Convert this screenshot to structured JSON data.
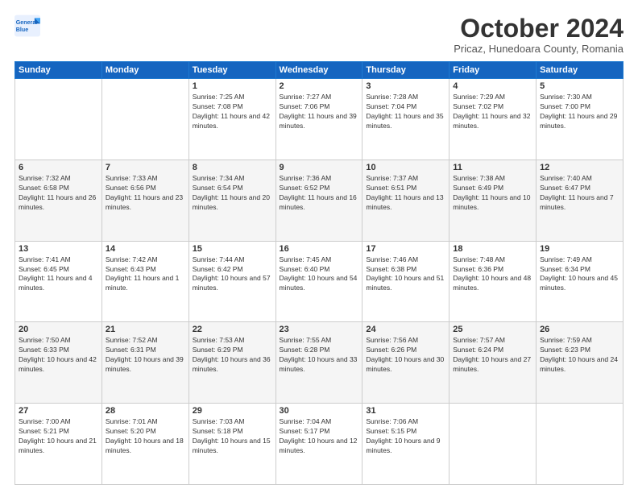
{
  "logo": {
    "line1": "General",
    "line2": "Blue"
  },
  "title": "October 2024",
  "location": "Pricaz, Hunedoara County, Romania",
  "days_of_week": [
    "Sunday",
    "Monday",
    "Tuesday",
    "Wednesday",
    "Thursday",
    "Friday",
    "Saturday"
  ],
  "weeks": [
    [
      {
        "day": "",
        "sunrise": "",
        "sunset": "",
        "daylight": ""
      },
      {
        "day": "",
        "sunrise": "",
        "sunset": "",
        "daylight": ""
      },
      {
        "day": "1",
        "sunrise": "Sunrise: 7:25 AM",
        "sunset": "Sunset: 7:08 PM",
        "daylight": "Daylight: 11 hours and 42 minutes."
      },
      {
        "day": "2",
        "sunrise": "Sunrise: 7:27 AM",
        "sunset": "Sunset: 7:06 PM",
        "daylight": "Daylight: 11 hours and 39 minutes."
      },
      {
        "day": "3",
        "sunrise": "Sunrise: 7:28 AM",
        "sunset": "Sunset: 7:04 PM",
        "daylight": "Daylight: 11 hours and 35 minutes."
      },
      {
        "day": "4",
        "sunrise": "Sunrise: 7:29 AM",
        "sunset": "Sunset: 7:02 PM",
        "daylight": "Daylight: 11 hours and 32 minutes."
      },
      {
        "day": "5",
        "sunrise": "Sunrise: 7:30 AM",
        "sunset": "Sunset: 7:00 PM",
        "daylight": "Daylight: 11 hours and 29 minutes."
      }
    ],
    [
      {
        "day": "6",
        "sunrise": "Sunrise: 7:32 AM",
        "sunset": "Sunset: 6:58 PM",
        "daylight": "Daylight: 11 hours and 26 minutes."
      },
      {
        "day": "7",
        "sunrise": "Sunrise: 7:33 AM",
        "sunset": "Sunset: 6:56 PM",
        "daylight": "Daylight: 11 hours and 23 minutes."
      },
      {
        "day": "8",
        "sunrise": "Sunrise: 7:34 AM",
        "sunset": "Sunset: 6:54 PM",
        "daylight": "Daylight: 11 hours and 20 minutes."
      },
      {
        "day": "9",
        "sunrise": "Sunrise: 7:36 AM",
        "sunset": "Sunset: 6:52 PM",
        "daylight": "Daylight: 11 hours and 16 minutes."
      },
      {
        "day": "10",
        "sunrise": "Sunrise: 7:37 AM",
        "sunset": "Sunset: 6:51 PM",
        "daylight": "Daylight: 11 hours and 13 minutes."
      },
      {
        "day": "11",
        "sunrise": "Sunrise: 7:38 AM",
        "sunset": "Sunset: 6:49 PM",
        "daylight": "Daylight: 11 hours and 10 minutes."
      },
      {
        "day": "12",
        "sunrise": "Sunrise: 7:40 AM",
        "sunset": "Sunset: 6:47 PM",
        "daylight": "Daylight: 11 hours and 7 minutes."
      }
    ],
    [
      {
        "day": "13",
        "sunrise": "Sunrise: 7:41 AM",
        "sunset": "Sunset: 6:45 PM",
        "daylight": "Daylight: 11 hours and 4 minutes."
      },
      {
        "day": "14",
        "sunrise": "Sunrise: 7:42 AM",
        "sunset": "Sunset: 6:43 PM",
        "daylight": "Daylight: 11 hours and 1 minute."
      },
      {
        "day": "15",
        "sunrise": "Sunrise: 7:44 AM",
        "sunset": "Sunset: 6:42 PM",
        "daylight": "Daylight: 10 hours and 57 minutes."
      },
      {
        "day": "16",
        "sunrise": "Sunrise: 7:45 AM",
        "sunset": "Sunset: 6:40 PM",
        "daylight": "Daylight: 10 hours and 54 minutes."
      },
      {
        "day": "17",
        "sunrise": "Sunrise: 7:46 AM",
        "sunset": "Sunset: 6:38 PM",
        "daylight": "Daylight: 10 hours and 51 minutes."
      },
      {
        "day": "18",
        "sunrise": "Sunrise: 7:48 AM",
        "sunset": "Sunset: 6:36 PM",
        "daylight": "Daylight: 10 hours and 48 minutes."
      },
      {
        "day": "19",
        "sunrise": "Sunrise: 7:49 AM",
        "sunset": "Sunset: 6:34 PM",
        "daylight": "Daylight: 10 hours and 45 minutes."
      }
    ],
    [
      {
        "day": "20",
        "sunrise": "Sunrise: 7:50 AM",
        "sunset": "Sunset: 6:33 PM",
        "daylight": "Daylight: 10 hours and 42 minutes."
      },
      {
        "day": "21",
        "sunrise": "Sunrise: 7:52 AM",
        "sunset": "Sunset: 6:31 PM",
        "daylight": "Daylight: 10 hours and 39 minutes."
      },
      {
        "day": "22",
        "sunrise": "Sunrise: 7:53 AM",
        "sunset": "Sunset: 6:29 PM",
        "daylight": "Daylight: 10 hours and 36 minutes."
      },
      {
        "day": "23",
        "sunrise": "Sunrise: 7:55 AM",
        "sunset": "Sunset: 6:28 PM",
        "daylight": "Daylight: 10 hours and 33 minutes."
      },
      {
        "day": "24",
        "sunrise": "Sunrise: 7:56 AM",
        "sunset": "Sunset: 6:26 PM",
        "daylight": "Daylight: 10 hours and 30 minutes."
      },
      {
        "day": "25",
        "sunrise": "Sunrise: 7:57 AM",
        "sunset": "Sunset: 6:24 PM",
        "daylight": "Daylight: 10 hours and 27 minutes."
      },
      {
        "day": "26",
        "sunrise": "Sunrise: 7:59 AM",
        "sunset": "Sunset: 6:23 PM",
        "daylight": "Daylight: 10 hours and 24 minutes."
      }
    ],
    [
      {
        "day": "27",
        "sunrise": "Sunrise: 7:00 AM",
        "sunset": "Sunset: 5:21 PM",
        "daylight": "Daylight: 10 hours and 21 minutes."
      },
      {
        "day": "28",
        "sunrise": "Sunrise: 7:01 AM",
        "sunset": "Sunset: 5:20 PM",
        "daylight": "Daylight: 10 hours and 18 minutes."
      },
      {
        "day": "29",
        "sunrise": "Sunrise: 7:03 AM",
        "sunset": "Sunset: 5:18 PM",
        "daylight": "Daylight: 10 hours and 15 minutes."
      },
      {
        "day": "30",
        "sunrise": "Sunrise: 7:04 AM",
        "sunset": "Sunset: 5:17 PM",
        "daylight": "Daylight: 10 hours and 12 minutes."
      },
      {
        "day": "31",
        "sunrise": "Sunrise: 7:06 AM",
        "sunset": "Sunset: 5:15 PM",
        "daylight": "Daylight: 10 hours and 9 minutes."
      },
      {
        "day": "",
        "sunrise": "",
        "sunset": "",
        "daylight": ""
      },
      {
        "day": "",
        "sunrise": "",
        "sunset": "",
        "daylight": ""
      }
    ]
  ]
}
